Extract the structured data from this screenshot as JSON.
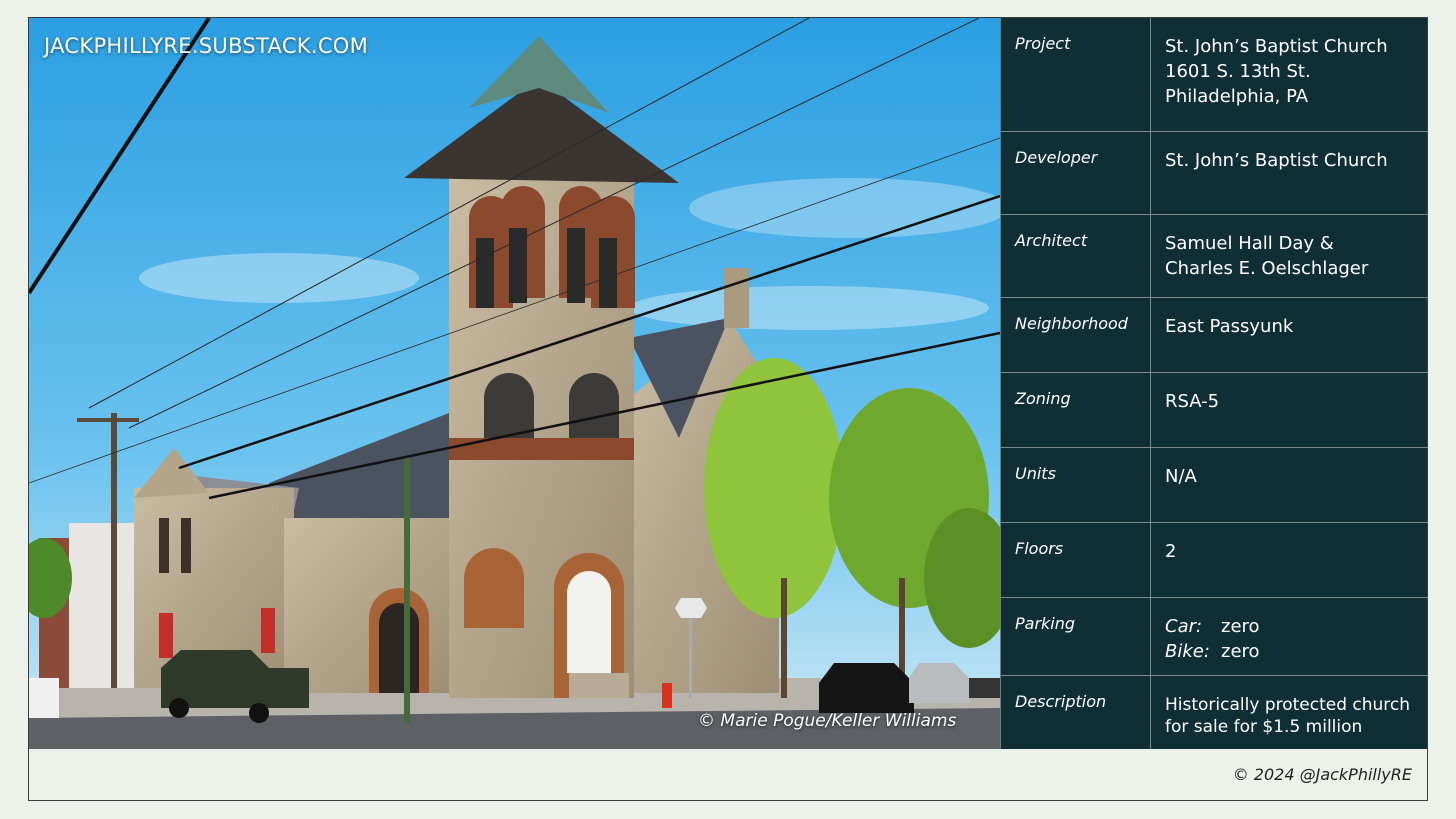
{
  "watermark": "JACKPHILLYRE.SUBSTACK.COM",
  "photo_credit": "© Marie Pogue/Keller Williams",
  "rows": [
    {
      "label": "Project",
      "lines": [
        "St. John’s Baptist Church",
        "1601 S. 13th St.",
        "Philadelphia, PA"
      ]
    },
    {
      "label": "Developer",
      "lines": [
        "St. John’s Baptist Church"
      ]
    },
    {
      "label": "Architect",
      "lines": [
        "Samuel Hall Day &",
        "Charles E. Oelschlager"
      ]
    },
    {
      "label": "Neighborhood",
      "lines": [
        "East Passyunk"
      ]
    },
    {
      "label": "Zoning",
      "lines": [
        "RSA-5"
      ]
    },
    {
      "label": "Units",
      "lines": [
        "N/A"
      ]
    },
    {
      "label": "Floors",
      "lines": [
        "2"
      ]
    },
    {
      "label": "Parking",
      "car_label": "Car:",
      "car_value": "zero",
      "bike_label": "Bike:",
      "bike_value": "zero"
    },
    {
      "label": "Description",
      "lines": [
        "Historically protected church",
        "for sale for $1.5 million"
      ]
    }
  ],
  "copyright": "© 2024 @JackPhillyRE",
  "colors": {
    "table_bg": "#0f2f35",
    "page_bg": "#ecf2ea",
    "sky": "#3aa9e6"
  }
}
